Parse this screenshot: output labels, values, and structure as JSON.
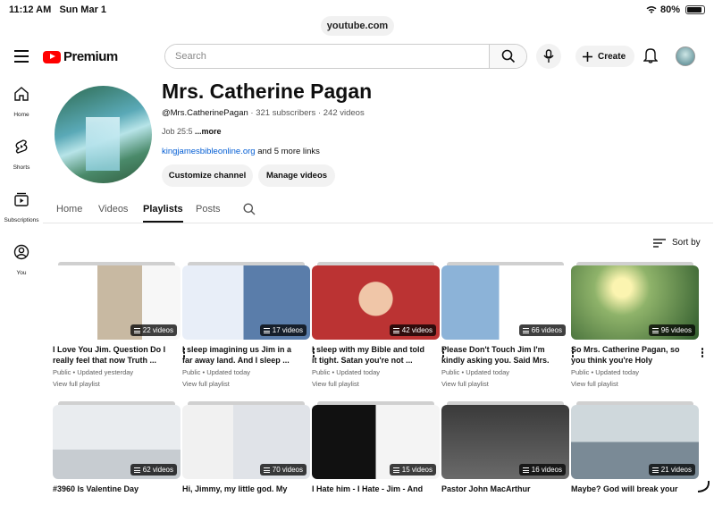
{
  "status_bar": {
    "time": "11:12 AM",
    "date": "Sun Mar 1",
    "battery": "80%"
  },
  "browser": {
    "url": "youtube.com"
  },
  "header": {
    "brand": "Premium",
    "search_placeholder": "Search",
    "create_label": "Create"
  },
  "sidebar": {
    "items": [
      {
        "label": "Home",
        "icon": "home-icon"
      },
      {
        "label": "Shorts",
        "icon": "shorts-icon"
      },
      {
        "label": "Subscriptions",
        "icon": "subscriptions-icon"
      },
      {
        "label": "You",
        "icon": "you-icon"
      }
    ]
  },
  "channel": {
    "name": "Mrs. Catherine Pagan",
    "handle": "@Mrs.CatherinePagan",
    "subscribers": "321 subscribers",
    "videos": "242 videos",
    "description": "Job 25:5",
    "more": "...more",
    "link": "kingjamesbibleonline.org",
    "more_links": "and 5 more links",
    "customize_label": "Customize channel",
    "manage_label": "Manage videos"
  },
  "tabs": [
    {
      "label": "Home"
    },
    {
      "label": "Videos"
    },
    {
      "label": "Playlists",
      "active": true
    },
    {
      "label": "Posts"
    }
  ],
  "sort_label": "Sort by",
  "playlists": [
    {
      "title": "I Love You Jim. Question Do I really feel that now Truth ...",
      "count": "22 videos",
      "meta": "Public • Updated yesterday",
      "view": "View full playlist"
    },
    {
      "title": "I sleep imagining us Jim in a far away land. And I sleep ...",
      "count": "17 videos",
      "meta": "Public • Updated today",
      "view": "View full playlist"
    },
    {
      "title": "I sleep with my Bible and told it tight. Satan you're not ...",
      "count": "42 videos",
      "meta": "Public • Updated today",
      "view": "View full playlist"
    },
    {
      "title": "Please Don't Touch Jim I'm kindly asking you. Said Mrs. ...",
      "count": "66 videos",
      "meta": "Public • Updated today",
      "view": "View full playlist"
    },
    {
      "title": "So Mrs. Catherine Pagan, so you think you're Holy Enoug...",
      "count": "96 videos",
      "meta": "Public • Updated today",
      "view": "View full playlist"
    },
    {
      "title": "#3960 Is Valentine Day",
      "count": "62 videos"
    },
    {
      "title": "Hi, Jimmy, my little god. My",
      "count": "70 videos"
    },
    {
      "title": "I Hate him - I Hate - Jim - And",
      "count": "15 videos"
    },
    {
      "title": "Pastor John MacArthur",
      "count": "16 videos"
    },
    {
      "title": "Maybe? God will break your",
      "count": "21 videos"
    }
  ]
}
